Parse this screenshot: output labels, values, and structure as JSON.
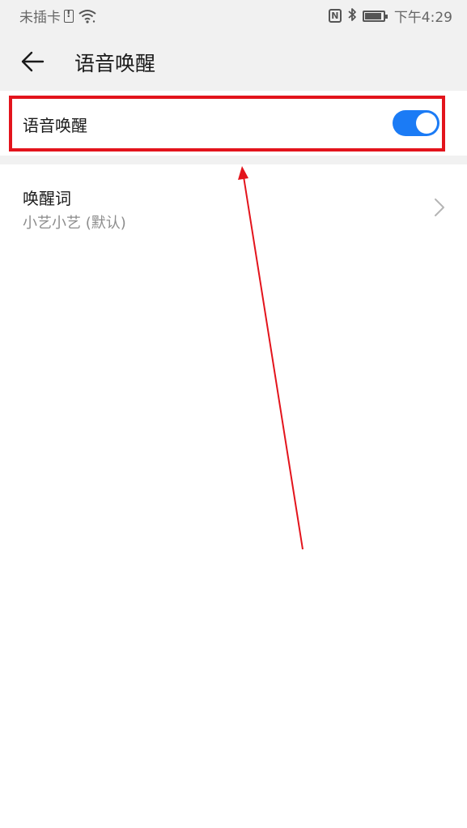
{
  "status_bar": {
    "carrier": "未插卡",
    "time": "下午4:29",
    "nfc_letter": "N",
    "icons": [
      "sim-alert-icon",
      "wifi-icon",
      "nfc-icon",
      "bluetooth-icon",
      "battery-icon"
    ]
  },
  "app_bar": {
    "title": "语音唤醒",
    "back_icon": "arrow-left-icon"
  },
  "settings": {
    "voice_wake": {
      "label": "语音唤醒",
      "enabled": true,
      "toggle_color": "#1b7bf5"
    },
    "wake_word": {
      "title": "唤醒词",
      "value": "小艺小艺 (默认)",
      "chevron_icon": "chevron-right-icon"
    }
  },
  "annotation": {
    "highlight_color": "#e3141c"
  }
}
